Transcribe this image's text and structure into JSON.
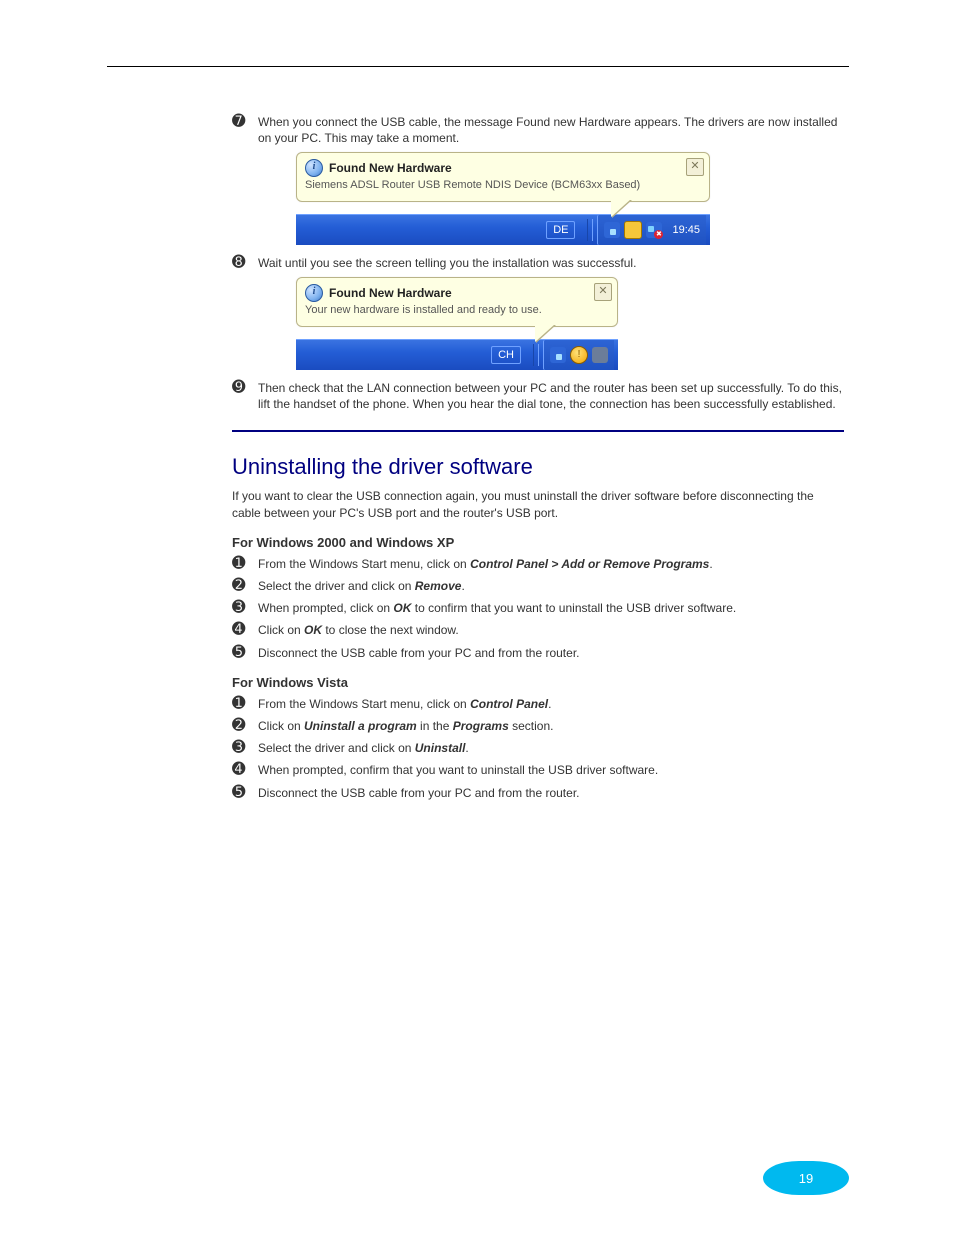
{
  "steps_continue": [
    {
      "num": "➐",
      "text": "When you connect the USB cable, the message Found new Hardware appears. The drivers are now installed on your PC. This may take a moment."
    },
    {
      "num": "➑",
      "text": "Wait until you see the screen telling you the installation was successful."
    },
    {
      "num": "➒",
      "text": "Then check that the LAN connection between your PC and the router has been set up successfully. To do this, lift the handset of the phone. When you hear the dial tone, the connection has been successfully established."
    }
  ],
  "screenshot1": {
    "title": "Found New Hardware",
    "body": "Siemens ADSL Router USB Remote NDIS Device (BCM63xx Based)",
    "lang": "DE",
    "clock": "19:45"
  },
  "screenshot2": {
    "title": "Found New Hardware",
    "body": "Your new hardware is installed and ready to use.",
    "lang": "CH"
  },
  "section_title": "Uninstalling the driver software",
  "section_intro": "If you want to clear the USB connection again, you must uninstall the driver software before disconnecting the cable between your PC's USB port and the router's USB port.",
  "xp_heading": "For Windows 2000 and Windows XP",
  "xp_steps": [
    {
      "num": "➊",
      "text_a": "From the Windows Start menu, click on ",
      "text_b": "Control Panel > Add or Remove Programs",
      "text_c": "."
    },
    {
      "num": "➋",
      "text_a": "Select the driver and click on ",
      "text_b": "Remove",
      "text_c": "."
    },
    {
      "num": "➌",
      "text_a": "When prompted, click on ",
      "text_b": "OK",
      "text_c": " to confirm that you want to uninstall the USB driver software."
    },
    {
      "num": "➍",
      "text_a": "Click on ",
      "text_b": "OK",
      "text_c": " to close the next window."
    },
    {
      "num": "➎",
      "text_a": "Disconnect the USB cable from your PC and from the router.",
      "text_b": "",
      "text_c": ""
    }
  ],
  "vista_heading": "For Windows Vista",
  "vista_steps": [
    {
      "num": "➊",
      "text_a": "From the Windows Start menu, click on ",
      "text_b": "Control Panel",
      "text_c": "."
    },
    {
      "num": "➋",
      "text_a": "Click on ",
      "text_b": "Uninstall a program",
      "text_c": " in the "
    },
    {
      "num": "➌",
      "text_a": "Select the driver and click on ",
      "text_b": "Uninstall",
      "text_c": "."
    },
    {
      "num": "➍",
      "text_a": "When prompted, confirm that you want to uninstall the USB driver software.",
      "text_b": "",
      "text_c": ""
    },
    {
      "num": "➎",
      "text_a": "Disconnect the USB cable from your PC and from the router.",
      "text_b": "",
      "text_c": ""
    }
  ],
  "vista_step2_extra": {
    "italic": "Programs",
    "tail": " section."
  },
  "page_number": "19",
  "footer": ""
}
